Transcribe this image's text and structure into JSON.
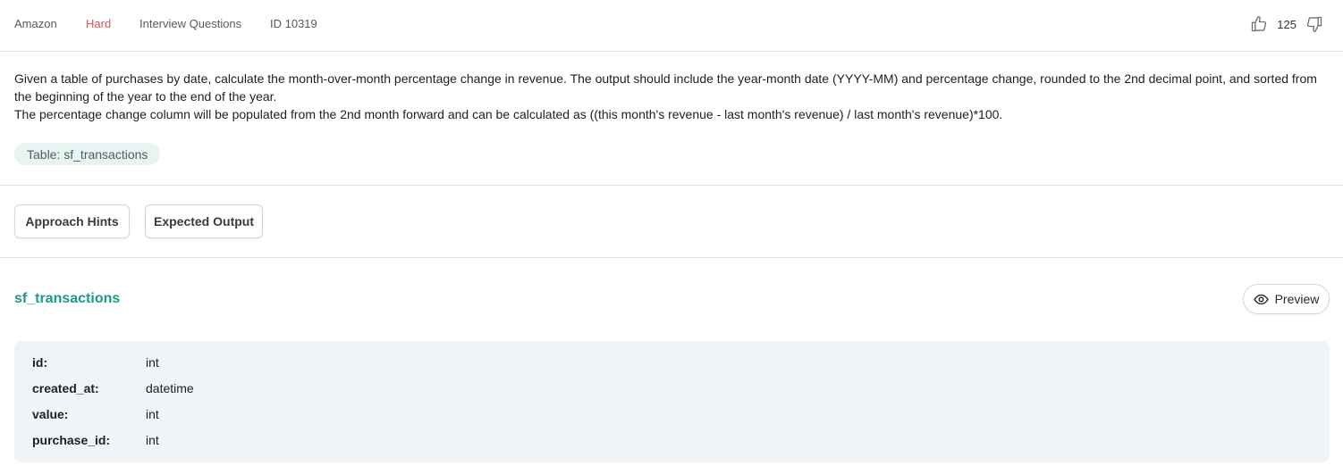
{
  "meta": {
    "company": "Amazon",
    "difficulty": "Hard",
    "difficulty_color": "#d9534f",
    "category": "Interview Questions",
    "question_id": "ID 10319"
  },
  "votes": {
    "upvote_icon": "thumbs-up-icon",
    "count": "125",
    "downvote_icon": "thumbs-down-icon"
  },
  "description": {
    "paragraph_1": "Given a table of purchases by date, calculate the month-over-month percentage change in revenue. The output should include the year-month date (YYYY-MM) and percentage change, rounded to the 2nd decimal point, and sorted from the beginning of the year to the end of the year.",
    "paragraph_2": "The percentage change column will be populated from the 2nd month forward and can be calculated as ((this month's revenue - last month's revenue) / last month's revenue)*100."
  },
  "table_chip": "Table: sf_transactions",
  "buttons": {
    "approach_hints": "Approach Hints",
    "expected_output": "Expected Output"
  },
  "table_section": {
    "title": "sf_transactions",
    "title_color": "#1a9a87",
    "preview_label": "Preview",
    "preview_icon": "eye-icon",
    "columns": [
      {
        "name": "id:",
        "type": "int"
      },
      {
        "name": "created_at:",
        "type": "datetime"
      },
      {
        "name": "value:",
        "type": "int"
      },
      {
        "name": "purchase_id:",
        "type": "int"
      }
    ]
  }
}
